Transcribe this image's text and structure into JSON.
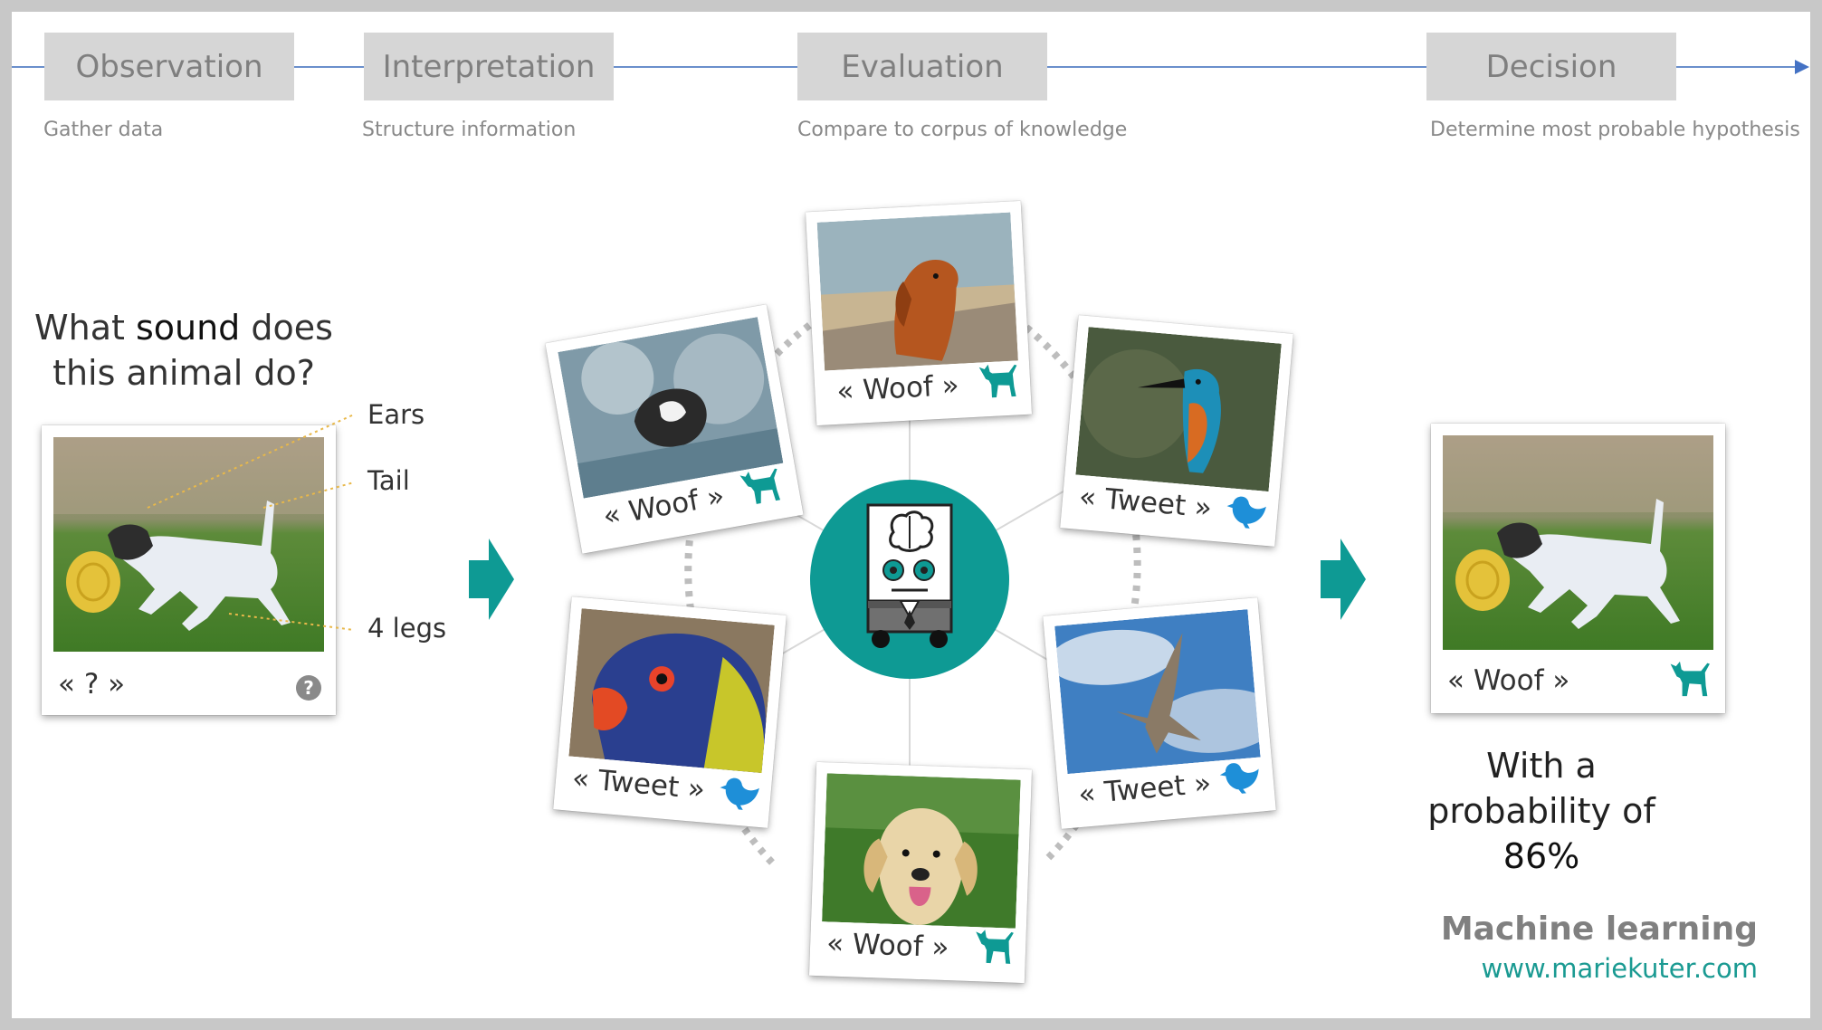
{
  "stages": [
    {
      "title": "Observation",
      "description": "Gather data"
    },
    {
      "title": "Interpretation",
      "description": "Structure information"
    },
    {
      "title": "Evaluation",
      "description": "Compare to corpus of knowledge"
    },
    {
      "title": "Decision",
      "description": "Determine most probable hypothesis"
    }
  ],
  "question": {
    "pre": "What ",
    "bold": "sound",
    "post": " does this animal do?"
  },
  "features": [
    "Ears",
    "Tail",
    "4 legs"
  ],
  "input_card": {
    "caption": "« ? »",
    "icon": "question-icon"
  },
  "corpus": [
    {
      "caption": "« Woof »",
      "icon": "dog-icon",
      "photo": "dog-splashing-water"
    },
    {
      "caption": "« Woof »",
      "icon": "dog-icon",
      "photo": "spaniel-on-beach"
    },
    {
      "caption": "« Tweet »",
      "icon": "bird-icon",
      "photo": "kingfisher"
    },
    {
      "caption": "« Tweet »",
      "icon": "bird-icon",
      "photo": "parrot"
    },
    {
      "caption": "« Woof »",
      "icon": "dog-icon",
      "photo": "golden-retriever"
    },
    {
      "caption": "« Tweet »",
      "icon": "bird-icon",
      "photo": "seagull-in-sky"
    }
  ],
  "result_card": {
    "caption": "« Woof »",
    "icon": "dog-icon"
  },
  "probability": {
    "pre": "With a probability of ",
    "value": "86%"
  },
  "brand": "Machine learning",
  "url": "www.mariekuter.com",
  "colors": {
    "teal": "#0e9a94",
    "bird_blue": "#1e8fd8",
    "timeline": "#4472c4",
    "stage_box": "#d6d6d6"
  }
}
